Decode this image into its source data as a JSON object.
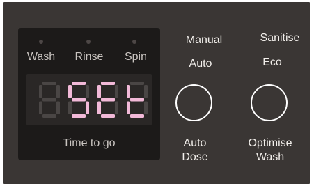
{
  "status_leds": [
    {
      "label": "Wash"
    },
    {
      "label": "Rinse"
    },
    {
      "label": "Spin"
    }
  ],
  "display": {
    "text": "SEt",
    "caption": "Time to go",
    "lit_color": "#f2b9d8",
    "unlit_color": "#4a4645"
  },
  "left_control": {
    "top_label": "Manual",
    "second_label": "Auto",
    "bottom_label_line1": "Auto",
    "bottom_label_line2": "Dose"
  },
  "right_control": {
    "top_label": "Sanitise",
    "second_label": "Eco",
    "bottom_label_line1": "Optimise",
    "bottom_label_line2": "Wash"
  },
  "colors": {
    "panel": "#3a3634",
    "display_bg": "#1c1a19",
    "text": "#f2efeb"
  }
}
